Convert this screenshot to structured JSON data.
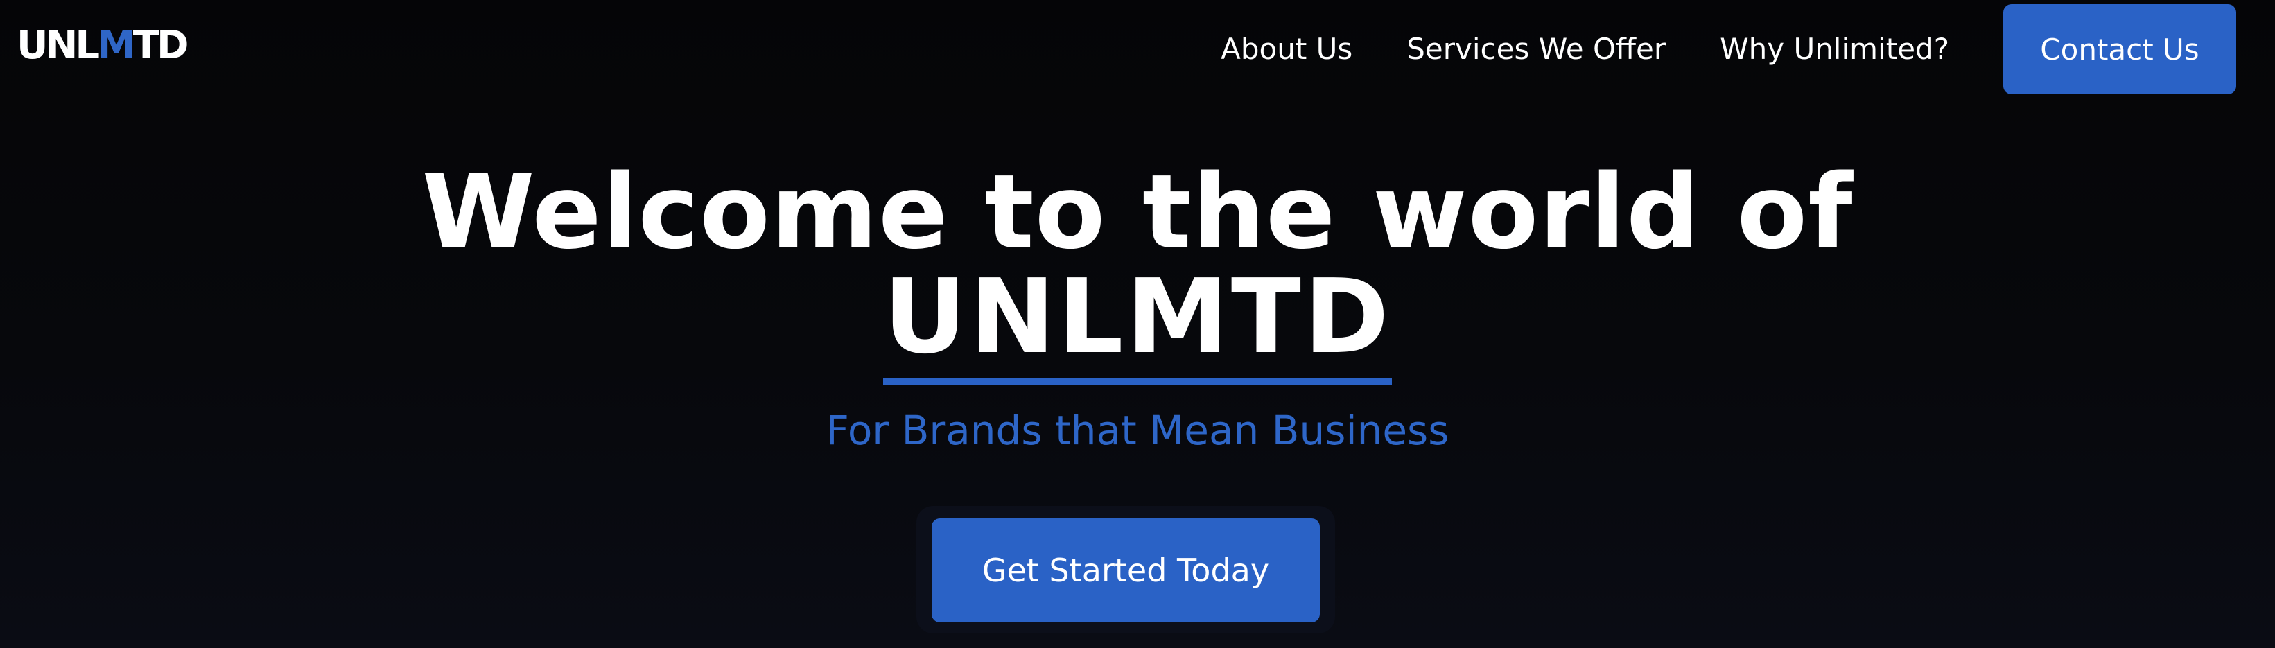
{
  "header": {
    "logo": {
      "part1": "UNL",
      "part2": "M",
      "part3": "TD"
    },
    "nav": [
      {
        "label": "About Us"
      },
      {
        "label": "Services We Offer"
      },
      {
        "label": "Why Unlimited?"
      }
    ],
    "contact_label": "Contact Us"
  },
  "hero": {
    "title_line1": "Welcome to the world of",
    "brand": "UNLMTD",
    "tagline": "For Brands that Mean Business",
    "cta_label": "Get Started Today"
  },
  "colors": {
    "accent": "#2a62c6",
    "background": "#050507",
    "text": "#ffffff"
  }
}
